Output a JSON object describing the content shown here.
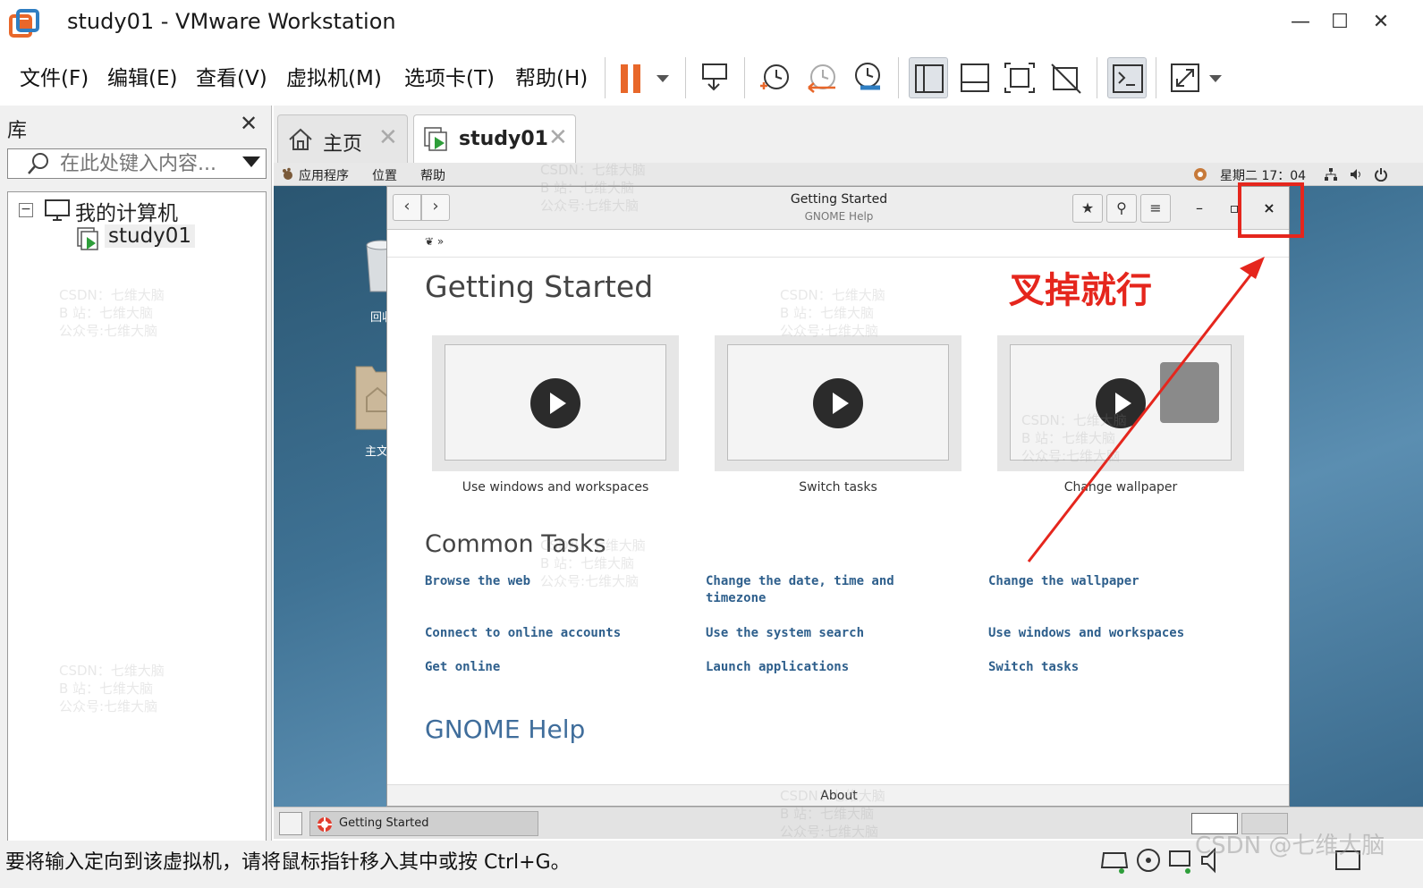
{
  "window": {
    "title": "study01 - VMware Workstation",
    "minimize": "—",
    "maximize": "☐",
    "close": "✕"
  },
  "menu": [
    "文件(F)",
    "编辑(E)",
    "查看(V)",
    "虚拟机(M)",
    "选项卡(T)",
    "帮助(H)"
  ],
  "library": {
    "title": "库",
    "close": "✕",
    "search_placeholder": "在此处键入内容...",
    "root": "我的计算机",
    "vm": "study01",
    "expand": "−"
  },
  "tabs": {
    "home": "主页",
    "vm": "study01",
    "close": "✕"
  },
  "gnome_topbar": {
    "apps": "应用程序",
    "places": "位置",
    "help": "帮助",
    "clock": "星期二 17：04"
  },
  "desktop": {
    "trash_label": "回收",
    "home_label": "主文"
  },
  "help_window": {
    "title": "Getting Started",
    "subtitle": "GNOME Help",
    "back": "‹",
    "forward": "›",
    "bookmark": "★",
    "search": "⚲",
    "menu": "≡",
    "minimize": "–",
    "maximize": "▫",
    "close": "×",
    "breadcrumb": "❦ »",
    "heading": "Getting Started",
    "videos": [
      "Use windows and workspaces",
      "Switch tasks",
      "Change wallpaper"
    ],
    "common_heading": "Common Tasks",
    "tasks": [
      [
        "Browse the web",
        "Change the date, time and timezone",
        "Change the wallpaper"
      ],
      [
        "Connect to online accounts",
        "Use the system search",
        "Use windows and workspaces"
      ],
      [
        "Get online",
        "Launch applications",
        "Switch tasks"
      ]
    ],
    "gnome_help": "GNOME Help",
    "footer": "About"
  },
  "annotation": {
    "text": "叉掉就行",
    "color": "#e5261d"
  },
  "taskbar": {
    "item": "Getting Started"
  },
  "statusbar": {
    "text": "要将输入定向到该虚拟机，请将鼠标指针移入其中或按 Ctrl+G。"
  },
  "watermark": {
    "lines": "CSDN：七维大脑\nB 站：七维大脑\n公众号:七维大脑",
    "corner": "CSDN @七维大脑"
  },
  "colors": {
    "accent_orange": "#e8672a",
    "link_blue": "#2e5f8c",
    "annotation_red": "#e5261d"
  }
}
